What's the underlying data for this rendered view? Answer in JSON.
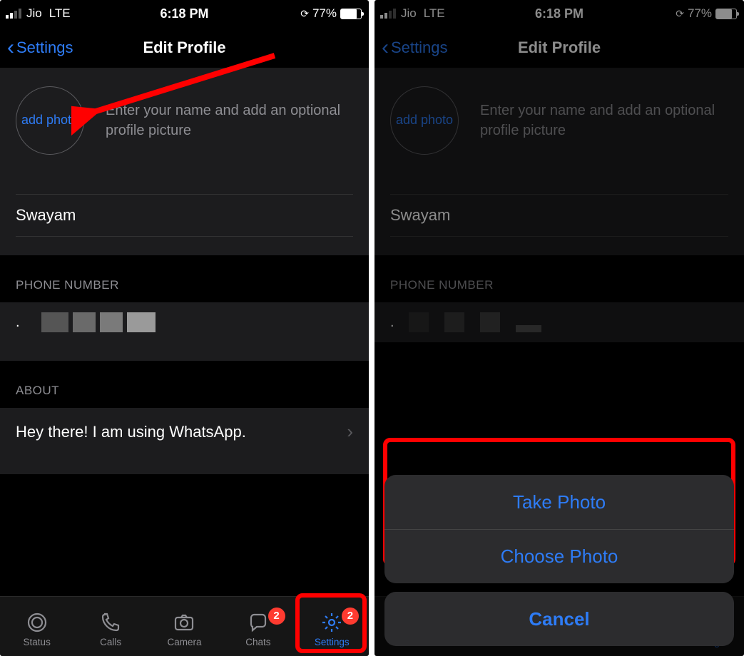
{
  "status": {
    "carrier": "Jio",
    "network": "LTE",
    "time": "6:18 PM",
    "battery_pct": "77%",
    "battery_fill": 77
  },
  "nav": {
    "back_label": "Settings",
    "title": "Edit Profile"
  },
  "profile": {
    "add_photo_label": "add photo",
    "hint": "Enter your name and add an optional profile picture",
    "name": "Swayam"
  },
  "sections": {
    "phone_header": "PHONE NUMBER",
    "about_header": "ABOUT",
    "about_text": "Hey there! I am using WhatsApp."
  },
  "tabs": {
    "status": "Status",
    "calls": "Calls",
    "camera": "Camera",
    "chats": "Chats",
    "settings": "Settings",
    "badge_chats": "2",
    "badge_settings": "2"
  },
  "sheet": {
    "take_photo": "Take Photo",
    "choose_photo": "Choose Photo",
    "cancel": "Cancel"
  }
}
